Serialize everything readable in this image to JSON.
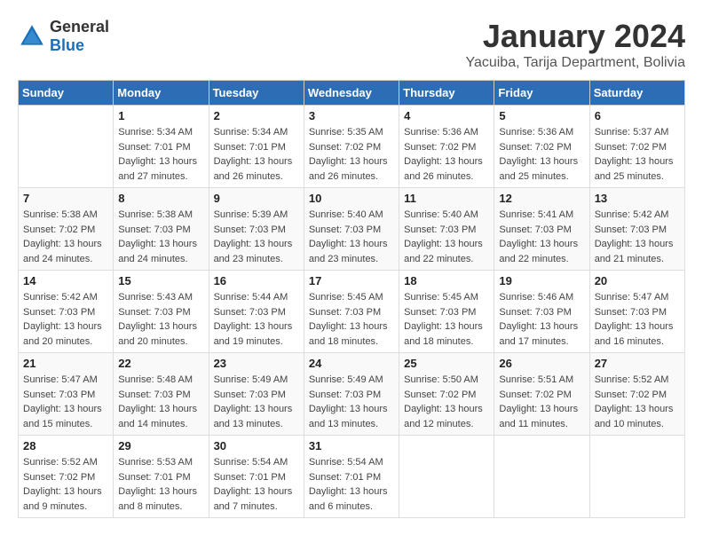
{
  "logo": {
    "general": "General",
    "blue": "Blue"
  },
  "title": "January 2024",
  "location": "Yacuiba, Tarija Department, Bolivia",
  "weekdays": [
    "Sunday",
    "Monday",
    "Tuesday",
    "Wednesday",
    "Thursday",
    "Friday",
    "Saturday"
  ],
  "weeks": [
    [
      {
        "day": "",
        "sunrise": "",
        "sunset": "",
        "daylight": ""
      },
      {
        "day": "1",
        "sunrise": "Sunrise: 5:34 AM",
        "sunset": "Sunset: 7:01 PM",
        "daylight": "Daylight: 13 hours and 27 minutes."
      },
      {
        "day": "2",
        "sunrise": "Sunrise: 5:34 AM",
        "sunset": "Sunset: 7:01 PM",
        "daylight": "Daylight: 13 hours and 26 minutes."
      },
      {
        "day": "3",
        "sunrise": "Sunrise: 5:35 AM",
        "sunset": "Sunset: 7:02 PM",
        "daylight": "Daylight: 13 hours and 26 minutes."
      },
      {
        "day": "4",
        "sunrise": "Sunrise: 5:36 AM",
        "sunset": "Sunset: 7:02 PM",
        "daylight": "Daylight: 13 hours and 26 minutes."
      },
      {
        "day": "5",
        "sunrise": "Sunrise: 5:36 AM",
        "sunset": "Sunset: 7:02 PM",
        "daylight": "Daylight: 13 hours and 25 minutes."
      },
      {
        "day": "6",
        "sunrise": "Sunrise: 5:37 AM",
        "sunset": "Sunset: 7:02 PM",
        "daylight": "Daylight: 13 hours and 25 minutes."
      }
    ],
    [
      {
        "day": "7",
        "sunrise": "Sunrise: 5:38 AM",
        "sunset": "Sunset: 7:02 PM",
        "daylight": "Daylight: 13 hours and 24 minutes."
      },
      {
        "day": "8",
        "sunrise": "Sunrise: 5:38 AM",
        "sunset": "Sunset: 7:03 PM",
        "daylight": "Daylight: 13 hours and 24 minutes."
      },
      {
        "day": "9",
        "sunrise": "Sunrise: 5:39 AM",
        "sunset": "Sunset: 7:03 PM",
        "daylight": "Daylight: 13 hours and 23 minutes."
      },
      {
        "day": "10",
        "sunrise": "Sunrise: 5:40 AM",
        "sunset": "Sunset: 7:03 PM",
        "daylight": "Daylight: 13 hours and 23 minutes."
      },
      {
        "day": "11",
        "sunrise": "Sunrise: 5:40 AM",
        "sunset": "Sunset: 7:03 PM",
        "daylight": "Daylight: 13 hours and 22 minutes."
      },
      {
        "day": "12",
        "sunrise": "Sunrise: 5:41 AM",
        "sunset": "Sunset: 7:03 PM",
        "daylight": "Daylight: 13 hours and 22 minutes."
      },
      {
        "day": "13",
        "sunrise": "Sunrise: 5:42 AM",
        "sunset": "Sunset: 7:03 PM",
        "daylight": "Daylight: 13 hours and 21 minutes."
      }
    ],
    [
      {
        "day": "14",
        "sunrise": "Sunrise: 5:42 AM",
        "sunset": "Sunset: 7:03 PM",
        "daylight": "Daylight: 13 hours and 20 minutes."
      },
      {
        "day": "15",
        "sunrise": "Sunrise: 5:43 AM",
        "sunset": "Sunset: 7:03 PM",
        "daylight": "Daylight: 13 hours and 20 minutes."
      },
      {
        "day": "16",
        "sunrise": "Sunrise: 5:44 AM",
        "sunset": "Sunset: 7:03 PM",
        "daylight": "Daylight: 13 hours and 19 minutes."
      },
      {
        "day": "17",
        "sunrise": "Sunrise: 5:45 AM",
        "sunset": "Sunset: 7:03 PM",
        "daylight": "Daylight: 13 hours and 18 minutes."
      },
      {
        "day": "18",
        "sunrise": "Sunrise: 5:45 AM",
        "sunset": "Sunset: 7:03 PM",
        "daylight": "Daylight: 13 hours and 18 minutes."
      },
      {
        "day": "19",
        "sunrise": "Sunrise: 5:46 AM",
        "sunset": "Sunset: 7:03 PM",
        "daylight": "Daylight: 13 hours and 17 minutes."
      },
      {
        "day": "20",
        "sunrise": "Sunrise: 5:47 AM",
        "sunset": "Sunset: 7:03 PM",
        "daylight": "Daylight: 13 hours and 16 minutes."
      }
    ],
    [
      {
        "day": "21",
        "sunrise": "Sunrise: 5:47 AM",
        "sunset": "Sunset: 7:03 PM",
        "daylight": "Daylight: 13 hours and 15 minutes."
      },
      {
        "day": "22",
        "sunrise": "Sunrise: 5:48 AM",
        "sunset": "Sunset: 7:03 PM",
        "daylight": "Daylight: 13 hours and 14 minutes."
      },
      {
        "day": "23",
        "sunrise": "Sunrise: 5:49 AM",
        "sunset": "Sunset: 7:03 PM",
        "daylight": "Daylight: 13 hours and 13 minutes."
      },
      {
        "day": "24",
        "sunrise": "Sunrise: 5:49 AM",
        "sunset": "Sunset: 7:03 PM",
        "daylight": "Daylight: 13 hours and 13 minutes."
      },
      {
        "day": "25",
        "sunrise": "Sunrise: 5:50 AM",
        "sunset": "Sunset: 7:02 PM",
        "daylight": "Daylight: 13 hours and 12 minutes."
      },
      {
        "day": "26",
        "sunrise": "Sunrise: 5:51 AM",
        "sunset": "Sunset: 7:02 PM",
        "daylight": "Daylight: 13 hours and 11 minutes."
      },
      {
        "day": "27",
        "sunrise": "Sunrise: 5:52 AM",
        "sunset": "Sunset: 7:02 PM",
        "daylight": "Daylight: 13 hours and 10 minutes."
      }
    ],
    [
      {
        "day": "28",
        "sunrise": "Sunrise: 5:52 AM",
        "sunset": "Sunset: 7:02 PM",
        "daylight": "Daylight: 13 hours and 9 minutes."
      },
      {
        "day": "29",
        "sunrise": "Sunrise: 5:53 AM",
        "sunset": "Sunset: 7:01 PM",
        "daylight": "Daylight: 13 hours and 8 minutes."
      },
      {
        "day": "30",
        "sunrise": "Sunrise: 5:54 AM",
        "sunset": "Sunset: 7:01 PM",
        "daylight": "Daylight: 13 hours and 7 minutes."
      },
      {
        "day": "31",
        "sunrise": "Sunrise: 5:54 AM",
        "sunset": "Sunset: 7:01 PM",
        "daylight": "Daylight: 13 hours and 6 minutes."
      },
      {
        "day": "",
        "sunrise": "",
        "sunset": "",
        "daylight": ""
      },
      {
        "day": "",
        "sunrise": "",
        "sunset": "",
        "daylight": ""
      },
      {
        "day": "",
        "sunrise": "",
        "sunset": "",
        "daylight": ""
      }
    ]
  ]
}
